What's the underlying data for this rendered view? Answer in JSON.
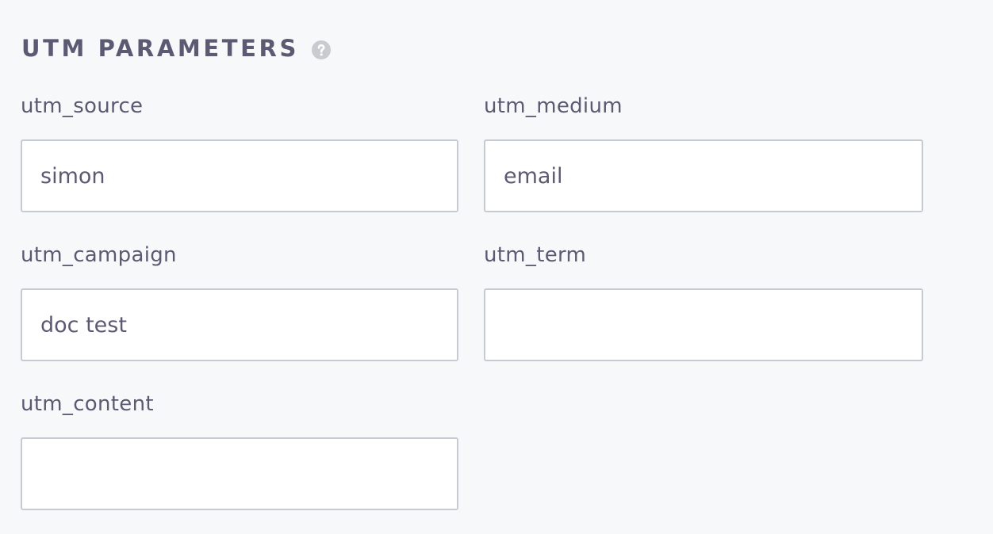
{
  "section": {
    "title": "UTM PARAMETERS",
    "help_icon": "question-mark-circle-icon"
  },
  "fields": {
    "utm_source": {
      "label": "utm_source",
      "value": "simon"
    },
    "utm_medium": {
      "label": "utm_medium",
      "value": "email"
    },
    "utm_campaign": {
      "label": "utm_campaign",
      "value": "doc test"
    },
    "utm_term": {
      "label": "utm_term",
      "value": ""
    },
    "utm_content": {
      "label": "utm_content",
      "value": ""
    }
  },
  "colors": {
    "background": "#f7f8fa",
    "text": "#5c5a72",
    "input_border": "#c6cbd2",
    "help_icon": "#c9cbd0"
  }
}
